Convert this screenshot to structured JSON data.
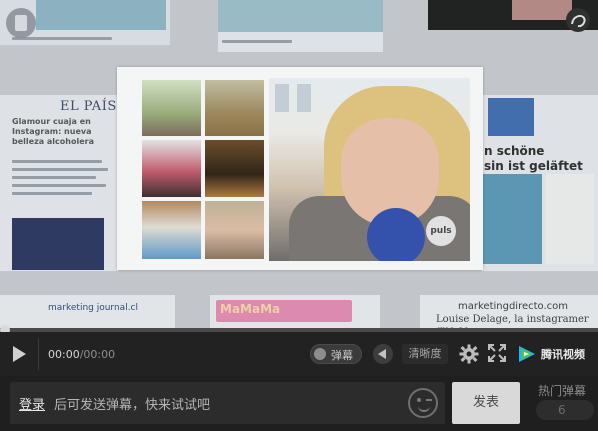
{
  "video": {
    "background": {
      "elpais_masthead": "EL PAÍS",
      "article_title": "Glamour cuaja en Instagram: nueva belleza alcoholera",
      "right_headline": "sin ist geläftet",
      "right_headline_prefix": "n schöne",
      "journal_logo": "marketing journal.cl",
      "mama_banner": "MaMaMa",
      "md_logo": "marketingdirecto.com",
      "md_sub": "Louise Delage, la instagramer que se"
    },
    "popup": {
      "watermark": "puls"
    }
  },
  "progress": {
    "fraction": 0
  },
  "controls": {
    "time_current": "00:00",
    "time_separator": "/",
    "time_duration": "00:00",
    "danmu_toggle_label": "弹幕",
    "quality_label": "清晰度",
    "brand_label": "腾讯视频",
    "icons": [
      "play-icon",
      "volume-icon",
      "gear-icon",
      "fullscreen-icon",
      "tencent-video-logo-icon"
    ]
  },
  "danmu": {
    "login_link": "登录",
    "hint": "后可发送弹幕，快来试试吧",
    "send_label": "发表",
    "hot_label": "热门弹幕",
    "hot_icon": "6"
  }
}
